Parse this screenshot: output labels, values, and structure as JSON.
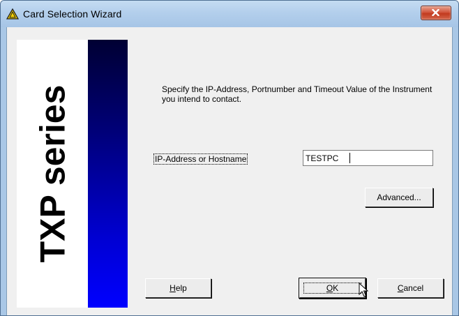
{
  "window": {
    "title": "Card Selection Wizard",
    "title_icon": "warning-triangle-icon",
    "close_icon": "close-icon"
  },
  "banner": {
    "text": "TXP series"
  },
  "instructions": "Specify the IP-Address, Portnumber and Timeout Value of the Instrument  you intend to contact.",
  "ip_field": {
    "label": "IP-Address or Hostname",
    "value": "TESTPC"
  },
  "buttons": {
    "advanced": "Advanced...",
    "help_mnemonic": "H",
    "help_rest": "elp",
    "ok_mnemonic": "O",
    "ok_rest": "K",
    "cancel_mnemonic": "C",
    "cancel_rest": "ancel"
  },
  "colors": {
    "banner_gradient_top": "#000033",
    "banner_gradient_bottom": "#0000ff",
    "titlebar": "#b3cfec",
    "close_button": "#c23a1e"
  }
}
